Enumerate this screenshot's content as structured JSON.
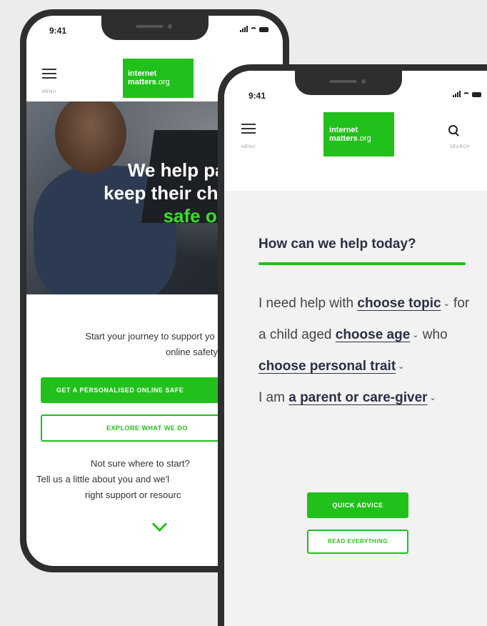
{
  "back_phone": {
    "status_time": "9:41",
    "menu_label": "MENU",
    "logo_line1": "internet",
    "logo_line2_bold": "matters",
    "logo_line2_suffix": ".org",
    "hero_line1": "We help paren",
    "hero_line2": "keep their childr",
    "hero_line3": "safe online",
    "journey_line1": "Start your journey to support yo",
    "journey_line2": "online safety",
    "primary_button": "GET A PERSONALISED ONLINE SAFE",
    "secondary_button": "EXPLORE WHAT WE DO",
    "notsure_line1": "Not sure where to start?",
    "notsure_line2": "Tell us a little about you and we'l",
    "notsure_line3": "right support or resourc"
  },
  "front_phone": {
    "status_time": "9:41",
    "menu_label": "MENU",
    "search_label": "SEARCH",
    "logo_line1": "internet",
    "logo_line2_bold": "matters",
    "logo_line2_suffix": ".org",
    "help_title": "How can we help today?",
    "sentence": {
      "t1": "I need help with ",
      "topic": "choose topic",
      "t2": " for a child aged ",
      "age": "choose age",
      "t3": " who ",
      "trait": "choose personal trait",
      "t4": "I am ",
      "role": "a parent or care-giver"
    },
    "quick_button": "QUICK ADVICE",
    "read_button": "READ EVERYTHING"
  },
  "colors": {
    "brand_green": "#22c01b",
    "frame": "#2e2e2e",
    "heading_navy": "#2a2f45"
  }
}
